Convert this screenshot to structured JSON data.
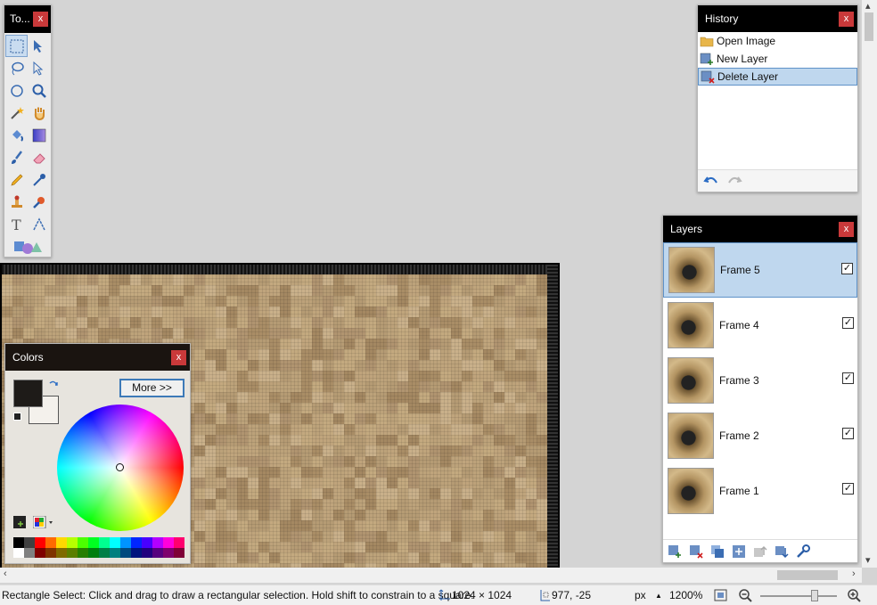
{
  "tools_window": {
    "title": "To...",
    "close": "x"
  },
  "history": {
    "title": "History",
    "close": "x",
    "items": [
      {
        "label": "Open Image",
        "icon": "folder-icon"
      },
      {
        "label": "New Layer",
        "icon": "new-layer-icon"
      },
      {
        "label": "Delete Layer",
        "icon": "delete-layer-icon",
        "selected": true
      }
    ]
  },
  "layers": {
    "title": "Layers",
    "close": "x",
    "items": [
      {
        "name": "Frame 5",
        "visible": "☑",
        "selected": true
      },
      {
        "name": "Frame 4",
        "visible": "☑"
      },
      {
        "name": "Frame 3",
        "visible": "☑"
      },
      {
        "name": "Frame 2",
        "visible": "☑"
      },
      {
        "name": "Frame 1",
        "visible": "☑"
      }
    ]
  },
  "colors": {
    "title": "Colors",
    "close": "x",
    "more_label": "More >>",
    "primary": "#1e1b18",
    "secondary": "#f4f1ec"
  },
  "status": {
    "hint": "Rectangle Select: Click and drag to draw a rectangular selection. Hold shift to constrain to a square.",
    "image_size": "1024 × 1024",
    "cursor_pos": "977, -25",
    "units": "px",
    "zoom": "1200%"
  }
}
